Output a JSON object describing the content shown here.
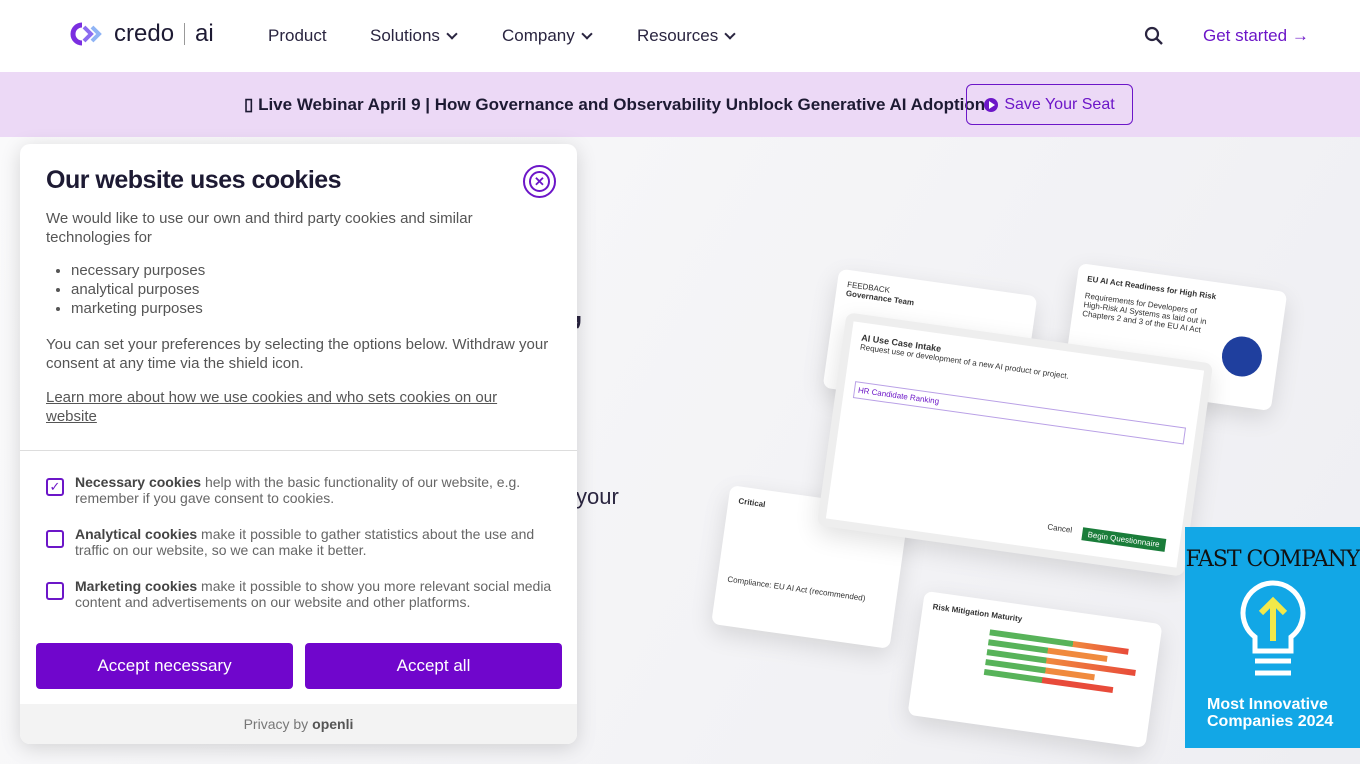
{
  "nav": {
    "logo_text": "credo",
    "logo_suffix": "ai",
    "items": [
      {
        "label": "Product"
      },
      {
        "label": "Solutions"
      },
      {
        "label": "Company"
      },
      {
        "label": "Resources"
      }
    ],
    "get_started": "Get started →"
  },
  "banner": {
    "text": "▯ Live Webinar April 9 | How Governance and Observability Unblock Generative AI Adoption",
    "button": "Save Your Seat"
  },
  "hero": {
    "fragment_comma": ",",
    "fragment_your": "your"
  },
  "cards": {
    "feedback": "FEEDBACK",
    "governance": "Governance Team",
    "eu_readiness": "EU AI Act Readiness for High Risk",
    "eu_req": "Requirements for Developers of High-Risk AI Systems as laid out in Chapters 2 and 3 of the EU AI Act",
    "intake": "AI Use Case Intake",
    "intake_sub": "Request use or development of a new AI product or project.",
    "use_case": "HR Candidate Ranking",
    "cancel": "Cancel",
    "begin": "Begin Questionnaire",
    "critical": "Critical",
    "compliance": "Compliance: EU AI Act (recommended)",
    "risk": "Risk Mitigation Maturity"
  },
  "fast_company": {
    "logo": "FAST COMPANY",
    "badge": "Most Innovative Companies 2024"
  },
  "cookie": {
    "title": "Our website uses cookies",
    "intro": "We would like to use our own and third party cookies and similar technologies for",
    "purposes": [
      "necessary purposes",
      "analytical purposes",
      "marketing purposes"
    ],
    "prefs": "You can set your preferences by selecting the options below. Withdraw your consent at any time via the shield icon.",
    "learn_more": "Learn more about how we use cookies and who sets cookies on our website",
    "options": [
      {
        "name": "Necessary cookies",
        "desc": " help with the basic functionality of our website, e.g. remember if you gave consent to cookies.",
        "checked": true
      },
      {
        "name": "Analytical cookies",
        "desc": " make it possible to gather statistics about the use and traffic on our website, so we can make it better.",
        "checked": false
      },
      {
        "name": "Marketing cookies",
        "desc": " make it possible to show you more relevant social media content and advertisements on our website and other platforms.",
        "checked": false
      }
    ],
    "accept_necessary": "Accept necessary",
    "accept_all": "Accept all",
    "privacy_by": "Privacy by",
    "provider": "openli"
  },
  "colors": {
    "accent": "#7006cc",
    "banner_bg": "#ecd9f6",
    "fast_company_bg": "#12a7e6"
  }
}
